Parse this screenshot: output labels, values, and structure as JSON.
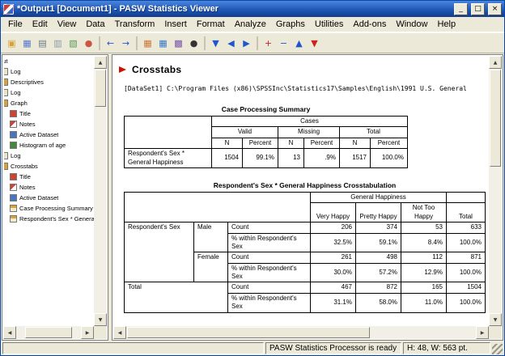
{
  "window": {
    "title": "*Output1 [Document1] - PASW Statistics Viewer"
  },
  "menu": {
    "items": [
      "File",
      "Edit",
      "View",
      "Data",
      "Transform",
      "Insert",
      "Format",
      "Analyze",
      "Graphs",
      "Utilities",
      "Add-ons",
      "Window",
      "Help"
    ]
  },
  "outline": {
    "items": [
      {
        "label": "Output"
      },
      {
        "label": "Log"
      },
      {
        "label": "Descriptives"
      },
      {
        "label": "Log"
      },
      {
        "label": "Graph"
      },
      {
        "label": "Title"
      },
      {
        "label": "Notes"
      },
      {
        "label": "Active Dataset"
      },
      {
        "label": "Histogram of age"
      },
      {
        "label": "Log"
      },
      {
        "label": "Crosstabs"
      },
      {
        "label": "Title"
      },
      {
        "label": "Notes"
      },
      {
        "label": "Active Dataset"
      },
      {
        "label": "Case Processing Summary"
      },
      {
        "label": "Respondent's Sex * General Happiness"
      }
    ]
  },
  "content": {
    "heading": "Crosstabs",
    "dataset_line": "[DataSet1] C:\\Program Files (x86)\\SPSSInc\\Statistics17\\Samples\\English\\1991 U.S. General",
    "case_processing": {
      "title": "Case Processing Summary",
      "cases_label": "Cases",
      "groups": [
        "Valid",
        "Missing",
        "Total"
      ],
      "subheads": [
        "N",
        "Percent",
        "N",
        "Percent",
        "N",
        "Percent"
      ],
      "row_label": "Respondent's Sex * General Happiness",
      "values": [
        "1504",
        "99.1%",
        "13",
        ".9%",
        "1517",
        "100.0%"
      ]
    },
    "crosstab": {
      "title": "Respondent's Sex * General Happiness Crosstabulation",
      "group_label": "General Happiness",
      "col_headers": [
        "Very Happy",
        "Pretty Happy",
        "Not Too Happy",
        "Total"
      ],
      "row_group_label": "Respondent's Sex",
      "male_label": "Male",
      "female_label": "Female",
      "total_label": "Total",
      "count_label": "Count",
      "pct_label": "% within Respondent's Sex",
      "male_count": [
        "206",
        "374",
        "53",
        "633"
      ],
      "male_pct": [
        "32.5%",
        "59.1%",
        "8.4%",
        "100.0%"
      ],
      "female_count": [
        "261",
        "498",
        "112",
        "871"
      ],
      "female_pct": [
        "30.0%",
        "57.2%",
        "12.9%",
        "100.0%"
      ],
      "total_count": [
        "467",
        "872",
        "165",
        "1504"
      ],
      "total_pct": [
        "31.1%",
        "58.0%",
        "11.0%",
        "100.0%"
      ]
    }
  },
  "status": {
    "processor": "PASW Statistics  Processor is ready",
    "dimensions": "H: 48, W: 563 pt."
  }
}
